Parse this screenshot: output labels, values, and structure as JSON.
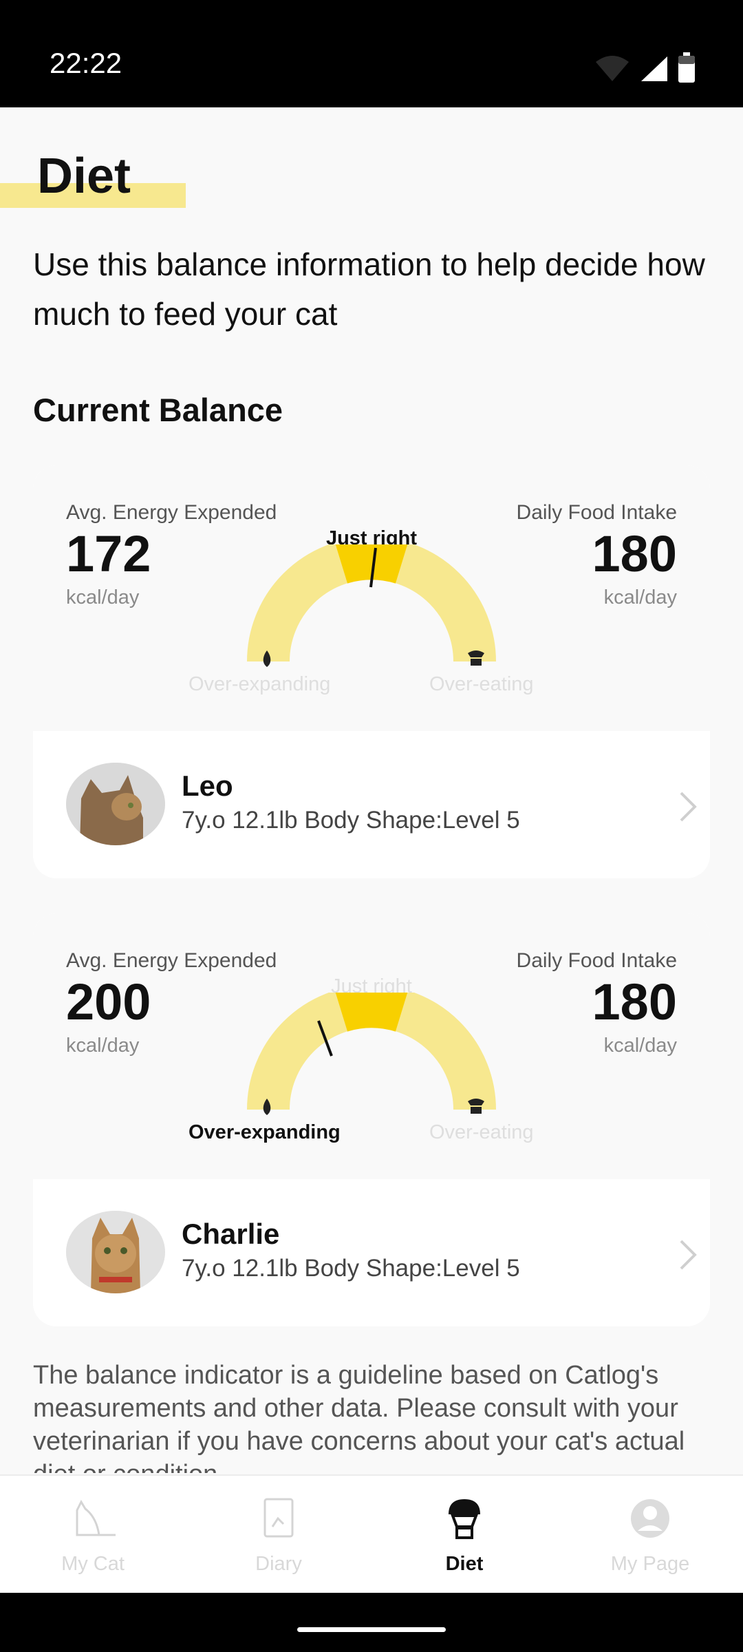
{
  "status_bar": {
    "time": "22:22"
  },
  "page": {
    "title": "Diet",
    "intro": "Use this balance information to help decide how much to feed your cat",
    "section_title": "Current Balance"
  },
  "cards": [
    {
      "energy_label": "Avg. Energy Expended",
      "energy_value": "172",
      "energy_unit": "kcal/day",
      "intake_label": "Daily Food Intake",
      "intake_value": "180",
      "intake_unit": "kcal/day",
      "gauge_labels": {
        "top": "Just right",
        "left": "Over-expanding",
        "right": "Over-eating"
      },
      "active_state": "Just right",
      "cat": {
        "name": "Leo",
        "meta": "7y.o 12.1lb Body Shape:Level 5"
      }
    },
    {
      "energy_label": "Avg. Energy Expended",
      "energy_value": "200",
      "energy_unit": "kcal/day",
      "intake_label": "Daily Food Intake",
      "intake_value": "180",
      "intake_unit": "kcal/day",
      "gauge_labels": {
        "top": "Just right",
        "left": "Over-expanding",
        "right": "Over-eating"
      },
      "active_state": "Over-expanding",
      "cat": {
        "name": "Charlie",
        "meta": "7y.o 12.1lb Body Shape:Level 5"
      }
    }
  ],
  "disclaimer": "The balance indicator is a guideline based on Catlog's measurements and other data. Please consult with your veterinarian if you have concerns about your cat's actual diet or condition.",
  "bottom_nav": [
    {
      "label": "My Cat",
      "icon": "cat-icon",
      "selected": false
    },
    {
      "label": "Diary",
      "icon": "diary-icon",
      "selected": false
    },
    {
      "label": "Diet",
      "icon": "food-bowl-icon",
      "selected": true
    },
    {
      "label": "My Page",
      "icon": "profile-icon",
      "selected": false
    }
  ],
  "colors": {
    "accent_yellow": "#f8d000",
    "light_yellow": "#f7e88f",
    "title_highlight": "#f7e88f"
  }
}
